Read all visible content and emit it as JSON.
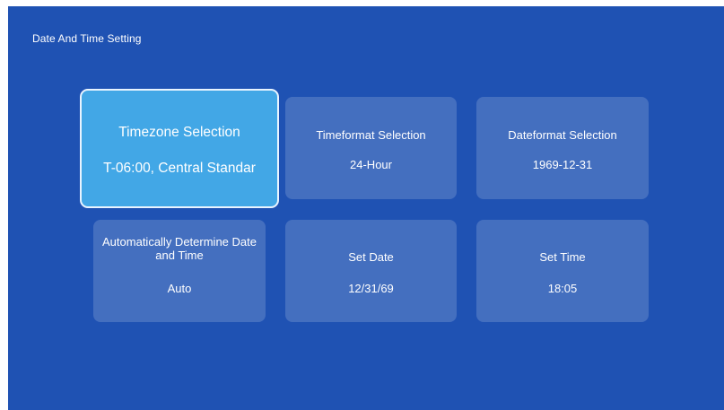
{
  "page": {
    "title": "Date And Time Setting"
  },
  "tiles": [
    {
      "label": "Timezone Selection",
      "value": "T-06:00, Central Standar"
    },
    {
      "label": "Timeformat Selection",
      "value": "24-Hour"
    },
    {
      "label": "Dateformat Selection",
      "value": "1969-12-31"
    },
    {
      "label": "Automatically Determine Date and Time",
      "value": "Auto"
    },
    {
      "label": "Set Date",
      "value": "12/31/69"
    },
    {
      "label": "Set Time",
      "value": "18:05"
    }
  ],
  "colors": {
    "background": "#1f52b3",
    "selected_tile": "#42a7e6",
    "tile": "rgba(255,255,255,0.17)",
    "text": "#ffffff"
  }
}
